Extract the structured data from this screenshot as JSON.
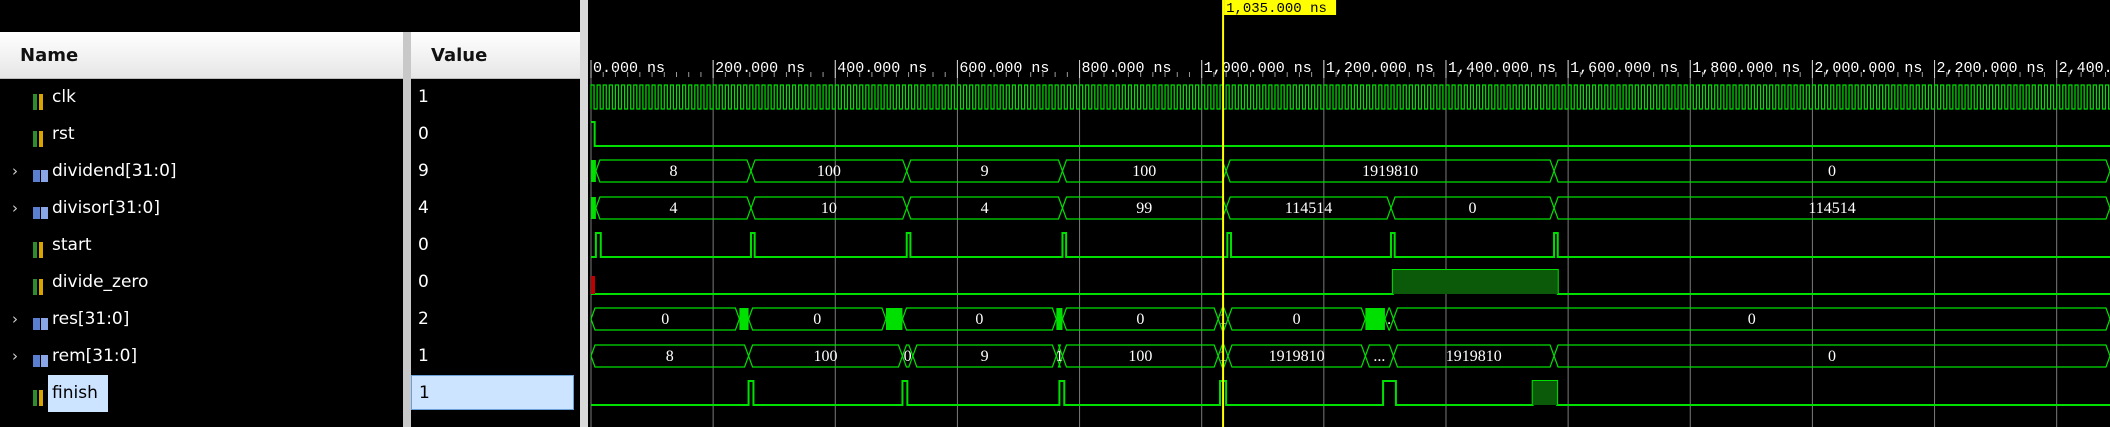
{
  "header": {
    "name": "Name",
    "value": "Value"
  },
  "signals": [
    {
      "name": "clk",
      "value": "1",
      "kind": "bit",
      "expandable": false
    },
    {
      "name": "rst",
      "value": "0",
      "kind": "bit",
      "expandable": false
    },
    {
      "name": "dividend[31:0]",
      "value": "9",
      "kind": "bus",
      "expandable": true
    },
    {
      "name": "divisor[31:0]",
      "value": "4",
      "kind": "bus",
      "expandable": true
    },
    {
      "name": "start",
      "value": "0",
      "kind": "bit",
      "expandable": false
    },
    {
      "name": "divide_zero",
      "value": "0",
      "kind": "bit",
      "expandable": false
    },
    {
      "name": "res[31:0]",
      "value": "2",
      "kind": "bus",
      "expandable": true
    },
    {
      "name": "rem[31:0]",
      "value": "1",
      "kind": "bus",
      "expandable": true
    },
    {
      "name": "finish",
      "value": "1",
      "kind": "bit",
      "expandable": false,
      "selected": true
    }
  ],
  "timeline": {
    "ticks": [
      "0.000 ns",
      "200.000 ns",
      "400.000 ns",
      "600.000 ns",
      "800.000 ns",
      "1,000.000 ns",
      "1,200.000 ns",
      "1,400.000 ns",
      "1,600.000 ns",
      "1,800.000 ns",
      "2,000.000 ns",
      "2,200.000 ns",
      "2,400."
    ],
    "cursor_label": "1,035.000 ns"
  },
  "bus_values": {
    "dividend": [
      "8",
      "100",
      "9",
      "100",
      "1919810",
      "0"
    ],
    "divisor": [
      "4",
      "10",
      "4",
      "99",
      "114514",
      "0",
      "114514"
    ],
    "res": [
      "0",
      "0",
      "0",
      "0",
      "1",
      "0",
      ".",
      "0"
    ],
    "rem": [
      "8",
      "100",
      "0",
      "9",
      "1",
      "100",
      "1",
      "1919810",
      "...",
      "1919810",
      "0"
    ]
  },
  "colors": {
    "wave": "#00e000",
    "cursor": "#ffff00",
    "selection": "#cce4ff",
    "error_marker": "#c00000"
  }
}
